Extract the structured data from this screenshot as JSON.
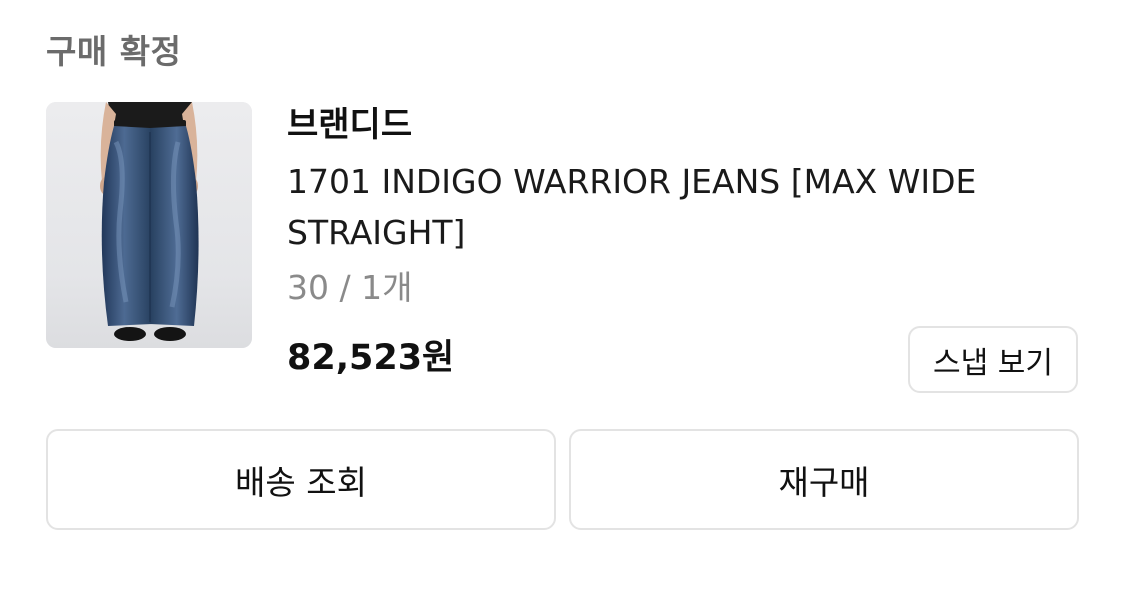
{
  "order": {
    "status_title": "구매 확정"
  },
  "product": {
    "brand": "브랜디드",
    "name": "1701 INDIGO WARRIOR JEANS [MAX WIDE STRAIGHT]",
    "option": "30 / 1개",
    "price": "82,523원",
    "image_icon": "product-photo-wide-jeans"
  },
  "buttons": {
    "snap": "스냅 보기",
    "delivery": "배송 조회",
    "rebuy": "재구매"
  },
  "colors": {
    "status_gray": "#6b6b6b",
    "option_gray": "#8a8a8a",
    "border": "#e3e3e3",
    "denim": "#2f4a6e"
  }
}
